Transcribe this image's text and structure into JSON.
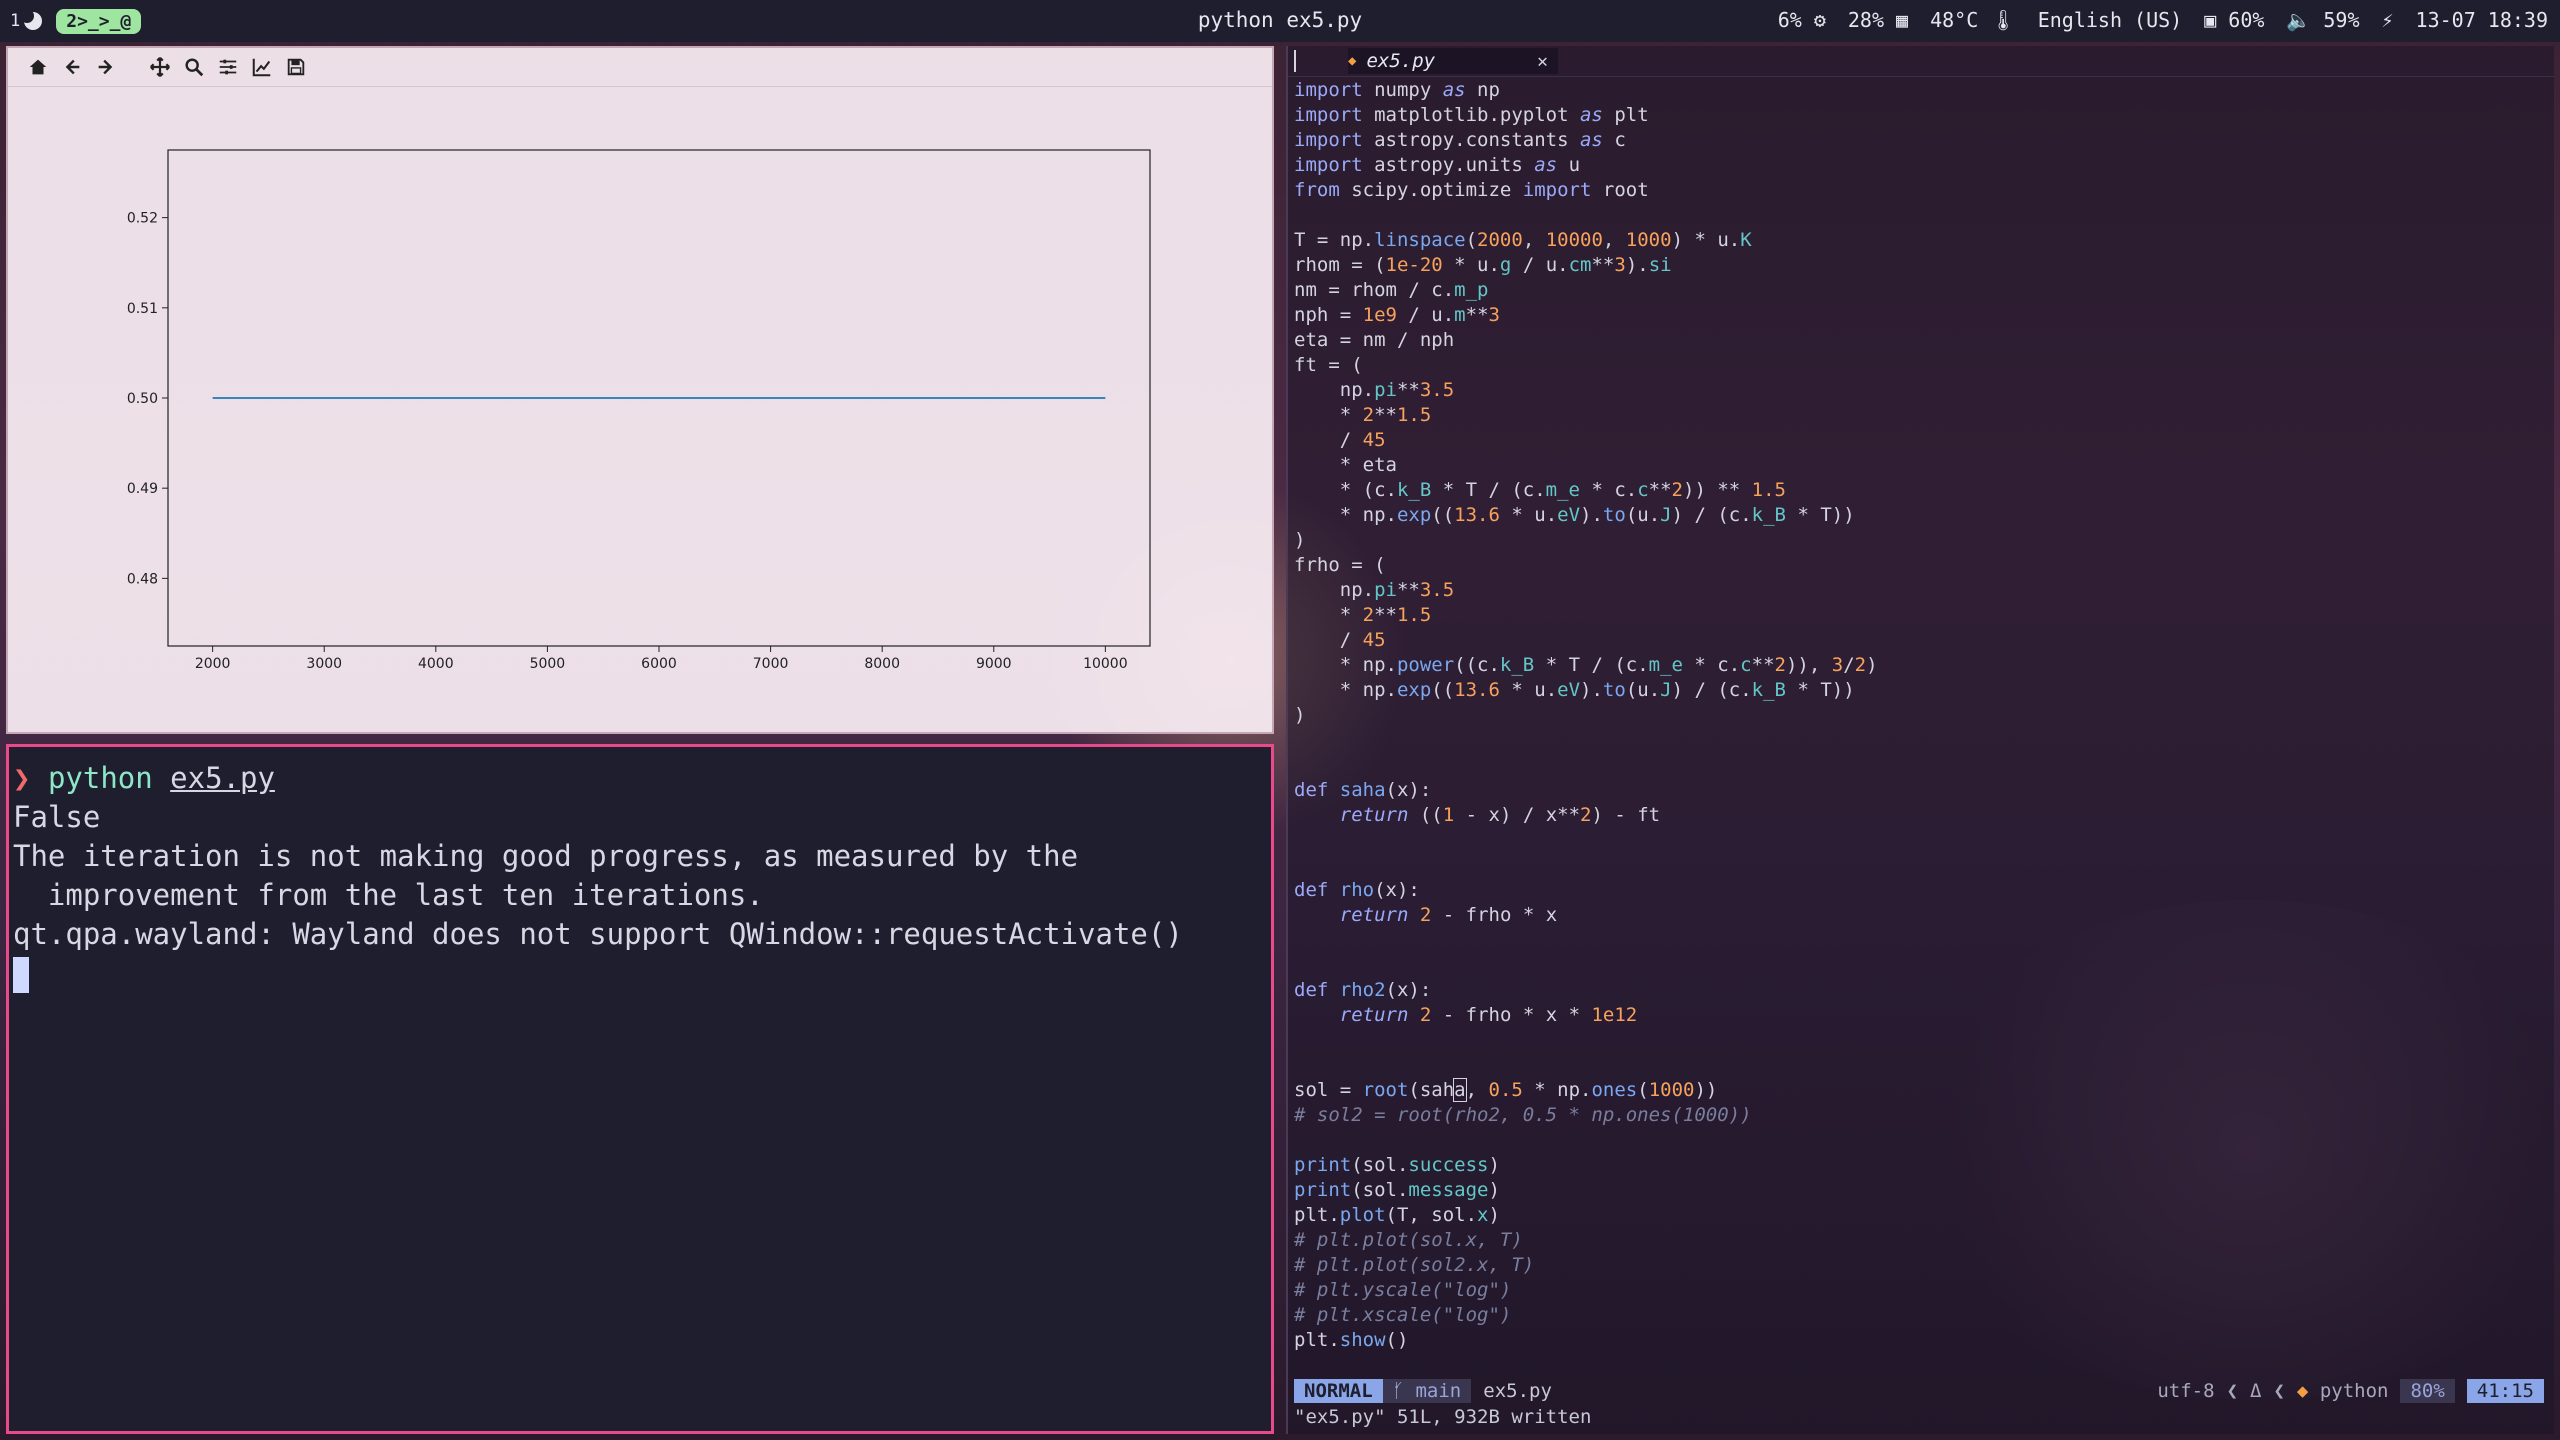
{
  "topbar": {
    "workspace_num": "1",
    "workspace_active": "2>_>_@",
    "window_title": "python ex5.py",
    "cpu": "6%",
    "mem": "28%",
    "temp": "48°C",
    "keyboard": "English (US)",
    "brightness": "60%",
    "volume": "59%",
    "battery_icon": "plug-icon",
    "datetime": "13-07 18:39"
  },
  "plot_window": {
    "toolbar": [
      "home-icon",
      "back-icon",
      "forward-icon",
      "pan-icon",
      "zoom-icon",
      "configure-subplots-icon",
      "edit-axis-icon",
      "save-icon"
    ]
  },
  "chart_data": {
    "type": "line",
    "series": [
      {
        "x": [
          2000,
          10000
        ],
        "y": [
          0.5,
          0.5
        ],
        "color": "#1f77b4"
      }
    ],
    "xlim": [
      1600,
      10400
    ],
    "ylim": [
      0.4725,
      0.5275
    ],
    "xticks": [
      "2000",
      "3000",
      "4000",
      "5000",
      "6000",
      "7000",
      "8000",
      "9000",
      "10000"
    ],
    "yticks": [
      "0.48",
      "0.49",
      "0.50",
      "0.51",
      "0.52"
    ],
    "xtick_values": [
      2000,
      3000,
      4000,
      5000,
      6000,
      7000,
      8000,
      9000,
      10000
    ],
    "ytick_values": [
      0.48,
      0.49,
      0.5,
      0.51,
      0.52
    ]
  },
  "terminal": {
    "prompt": "❯",
    "cmd": "python",
    "arg": "ex5.py",
    "out1": "False",
    "out2": "The iteration is not making good progress, as measured by the",
    "out3": "  improvement from the last ten iterations.",
    "out4": "qt.qpa.wayland: Wayland does not support QWindow::requestActivate()"
  },
  "editor": {
    "tab_name": "ex5.py",
    "mode": "NORMAL",
    "branch": "main",
    "filename": "ex5.py",
    "encoding": "utf-8",
    "lang": "python",
    "percent": "80%",
    "position": "41:15",
    "message": "\"ex5.py\" 51L, 932B written"
  }
}
